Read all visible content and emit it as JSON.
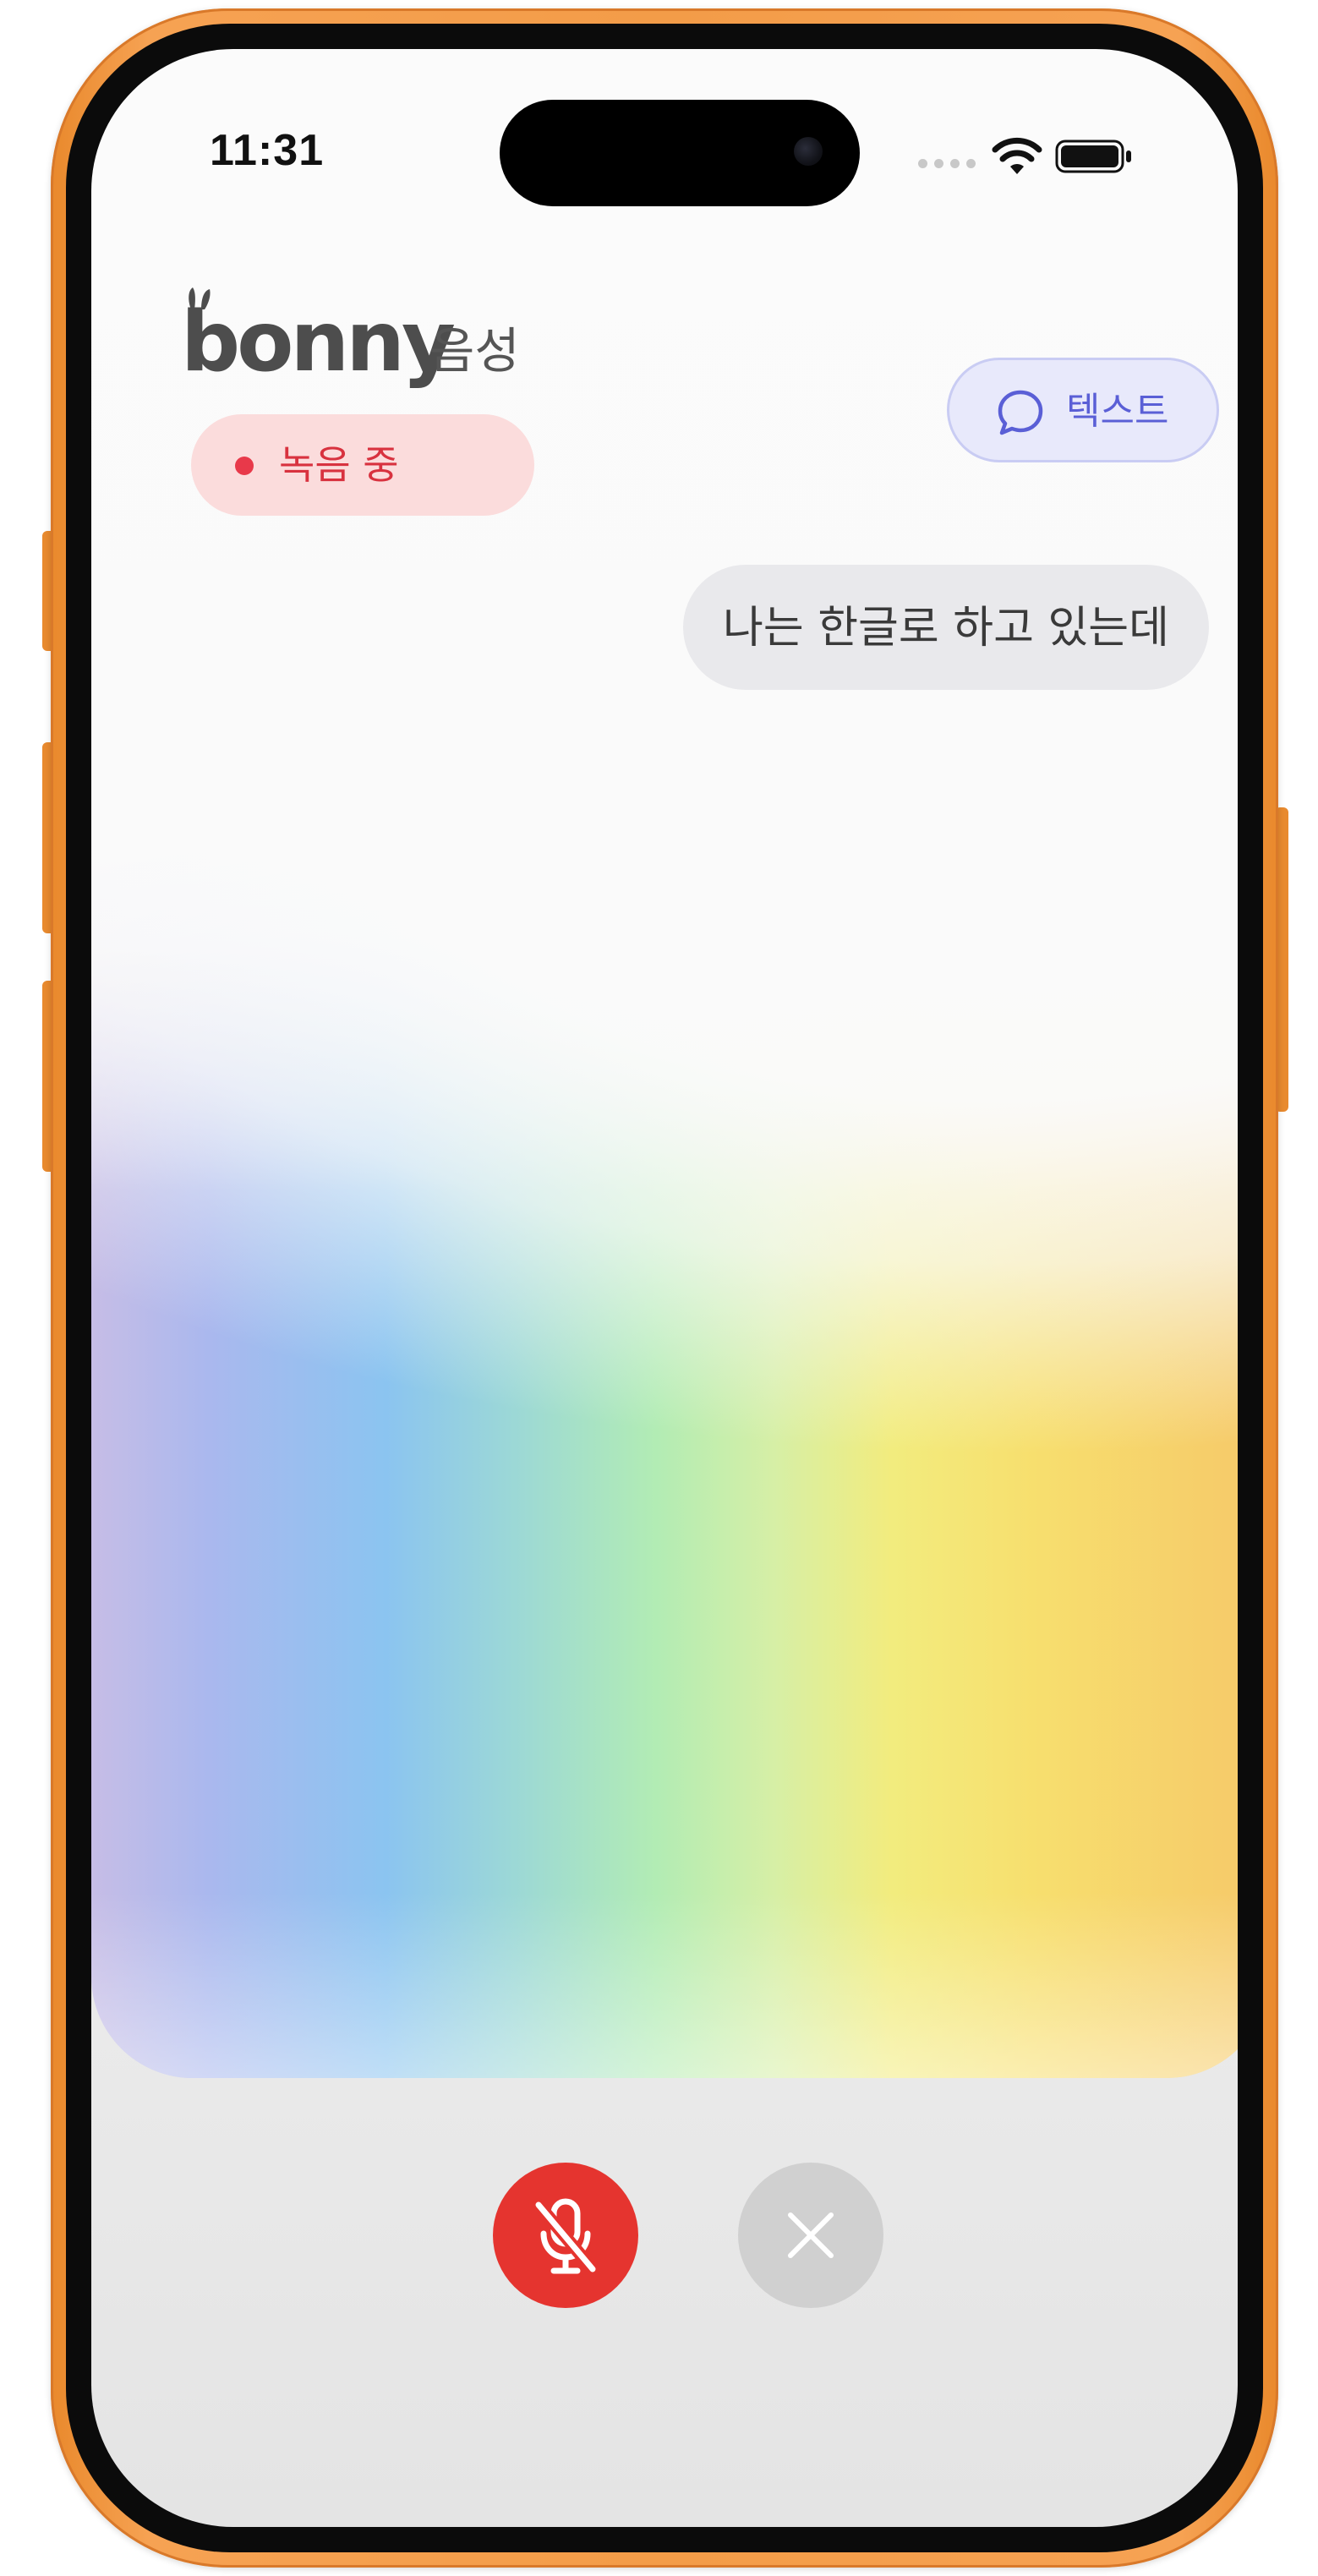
{
  "status_bar": {
    "time": "11:31",
    "icons": [
      "cellular-signal-icon",
      "wifi-icon",
      "battery-icon"
    ]
  },
  "header": {
    "brand": "bonny",
    "mode_label": "음성",
    "recording_badge": "녹음 중",
    "text_mode_button": "텍스트"
  },
  "conversation": {
    "user_message": "나는 한글로 하고 있는데"
  },
  "controls": {
    "mute_icon": "mic-off-icon",
    "close_icon": "close-icon"
  },
  "colors": {
    "device_frame": "#f39c48",
    "recording_bg": "#fbdcdc",
    "recording_text": "#d8323f",
    "text_button_bg": "#e8e9fb",
    "text_button_fg": "#5a5fd6",
    "bubble_bg": "#e9e9ec",
    "mute_button": "#e5342f",
    "close_button": "#d0d0d0"
  }
}
